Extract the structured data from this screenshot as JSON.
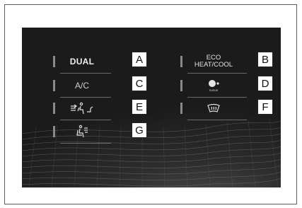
{
  "buttons": {
    "dual": {
      "label": "DUAL",
      "callout": "A"
    },
    "eco": {
      "label_line1": "ECO",
      "label_line2": "HEAT/COOL",
      "callout": "B"
    },
    "ac": {
      "label": "A/C",
      "callout": "C"
    },
    "nanoe": {
      "label": "nanoe",
      "icon": "nanoe-icon",
      "callout": "D"
    },
    "airflow": {
      "icon": "airflow-mode-icon",
      "callout": "E"
    },
    "defroster": {
      "icon": "windshield-defroster-icon",
      "callout": "F"
    },
    "seat": {
      "icon": "seat-air-icon",
      "callout": "G"
    }
  },
  "colors": {
    "panel_background": "#1b1b1b",
    "label_text": "#e8e8e8",
    "indicator_bar": "#8a8a8a",
    "callout_background": "#ffffff"
  }
}
